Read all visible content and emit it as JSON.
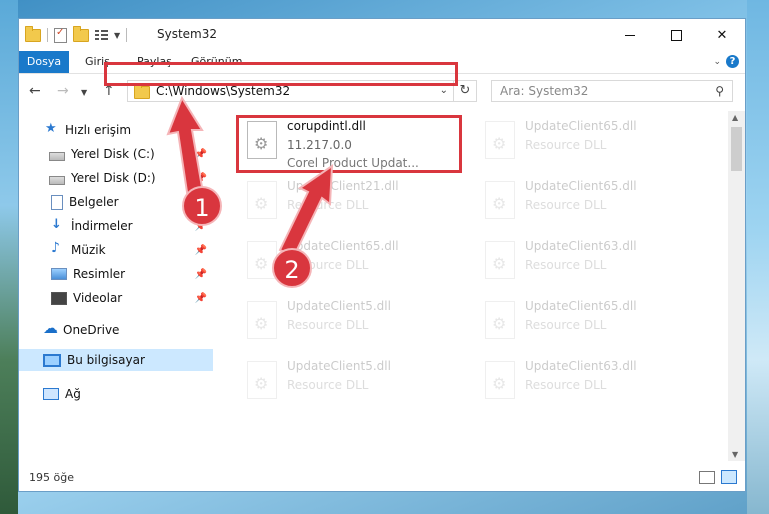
{
  "titlebar": {
    "title": "System32",
    "quick_access": [
      "folder-icon",
      "properties-icon",
      "new-folder-icon",
      "view-icon"
    ]
  },
  "ribbon": {
    "tabs": [
      "Dosya",
      "Giriş",
      "Paylaş",
      "Görünüm"
    ],
    "help_label": "?"
  },
  "navigation": {
    "address": "C:\\Windows\\System32",
    "search_placeholder": "Ara: System32"
  },
  "sidebar": {
    "items": [
      {
        "label": "Hızlı erişim",
        "icon": "star-icon"
      },
      {
        "label": "Yerel Disk (C:)",
        "icon": "disk-icon",
        "pinned": true
      },
      {
        "label": "Yerel Disk (D:)",
        "icon": "disk-icon",
        "pinned": true
      },
      {
        "label": "Belgeler",
        "icon": "document-icon",
        "pinned": true
      },
      {
        "label": "İndirmeler",
        "icon": "download-icon",
        "pinned": true
      },
      {
        "label": "Müzik",
        "icon": "music-icon",
        "pinned": true
      },
      {
        "label": "Resimler",
        "icon": "pictures-icon",
        "pinned": true
      },
      {
        "label": "Videolar",
        "icon": "video-icon",
        "pinned": true
      },
      {
        "label": "OneDrive",
        "icon": "cloud-icon"
      },
      {
        "label": "Bu bilgisayar",
        "icon": "computer-icon",
        "selected": true
      },
      {
        "label": "Ağ",
        "icon": "network-icon"
      }
    ]
  },
  "files": [
    {
      "name": "corupdintl.dll",
      "version": "11.217.0.0",
      "description": "Corel Product Updat...",
      "highlighted": true
    },
    {
      "name": "UpdateClient65.dll",
      "description": "Resource DLL"
    },
    {
      "name": "UpdateClient21.dll",
      "description": "Resource DLL"
    },
    {
      "name": "UpdateClient65.dll",
      "description": "Resource DLL"
    },
    {
      "name": "UpdateClient65.dll",
      "description": "Resource DLL"
    },
    {
      "name": "UpdateClient63.dll",
      "description": "Resource DLL"
    },
    {
      "name": "UpdateClient5.dll",
      "description": "Resource DLL"
    },
    {
      "name": "UpdateClient65.dll",
      "description": "Resource DLL"
    },
    {
      "name": "UpdateClient5.dll",
      "description": "Resource DLL"
    },
    {
      "name": "UpdateClient63.dll",
      "description": "Resource DLL"
    }
  ],
  "status": {
    "item_count": "195 öğe"
  },
  "annotations": {
    "step1": "1",
    "step2": "2",
    "color": "#d9363e"
  }
}
